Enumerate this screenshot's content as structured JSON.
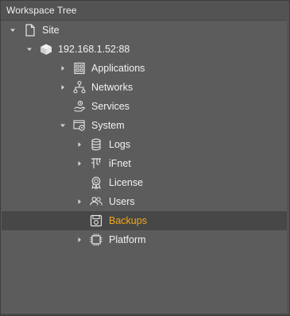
{
  "panel": {
    "title": "Workspace Tree"
  },
  "tree": {
    "site": {
      "label": "Site",
      "icon": "page-icon",
      "state": "expanded"
    },
    "device": {
      "label": "192.168.1.52:88",
      "icon": "device-cube-icon",
      "state": "expanded"
    },
    "applications": {
      "label": "Applications",
      "icon": "applications-grid-icon",
      "state": "collapsed"
    },
    "networks": {
      "label": "Networks",
      "icon": "network-icon",
      "state": "collapsed"
    },
    "services": {
      "label": "Services",
      "icon": "services-hand-icon",
      "state": "leaf"
    },
    "system": {
      "label": "System",
      "icon": "system-settings-icon",
      "state": "expanded"
    },
    "logs": {
      "label": "Logs",
      "icon": "database-icon",
      "state": "collapsed"
    },
    "ifnet": {
      "label": "iFnet",
      "icon": "ifnet-plug-icon",
      "state": "collapsed"
    },
    "license": {
      "label": "License",
      "icon": "license-badge-icon",
      "state": "leaf"
    },
    "users": {
      "label": "Users",
      "icon": "users-icon",
      "state": "collapsed"
    },
    "backups": {
      "label": "Backups",
      "icon": "backup-disk-icon",
      "state": "leaf",
      "selected": true
    },
    "platform": {
      "label": "Platform",
      "icon": "chip-icon",
      "state": "collapsed"
    }
  },
  "colors": {
    "background": "#5c5c5c",
    "header": "#535353",
    "text": "#f2f2f2",
    "selected_row": "#474747",
    "selected_text": "#f2a818"
  }
}
